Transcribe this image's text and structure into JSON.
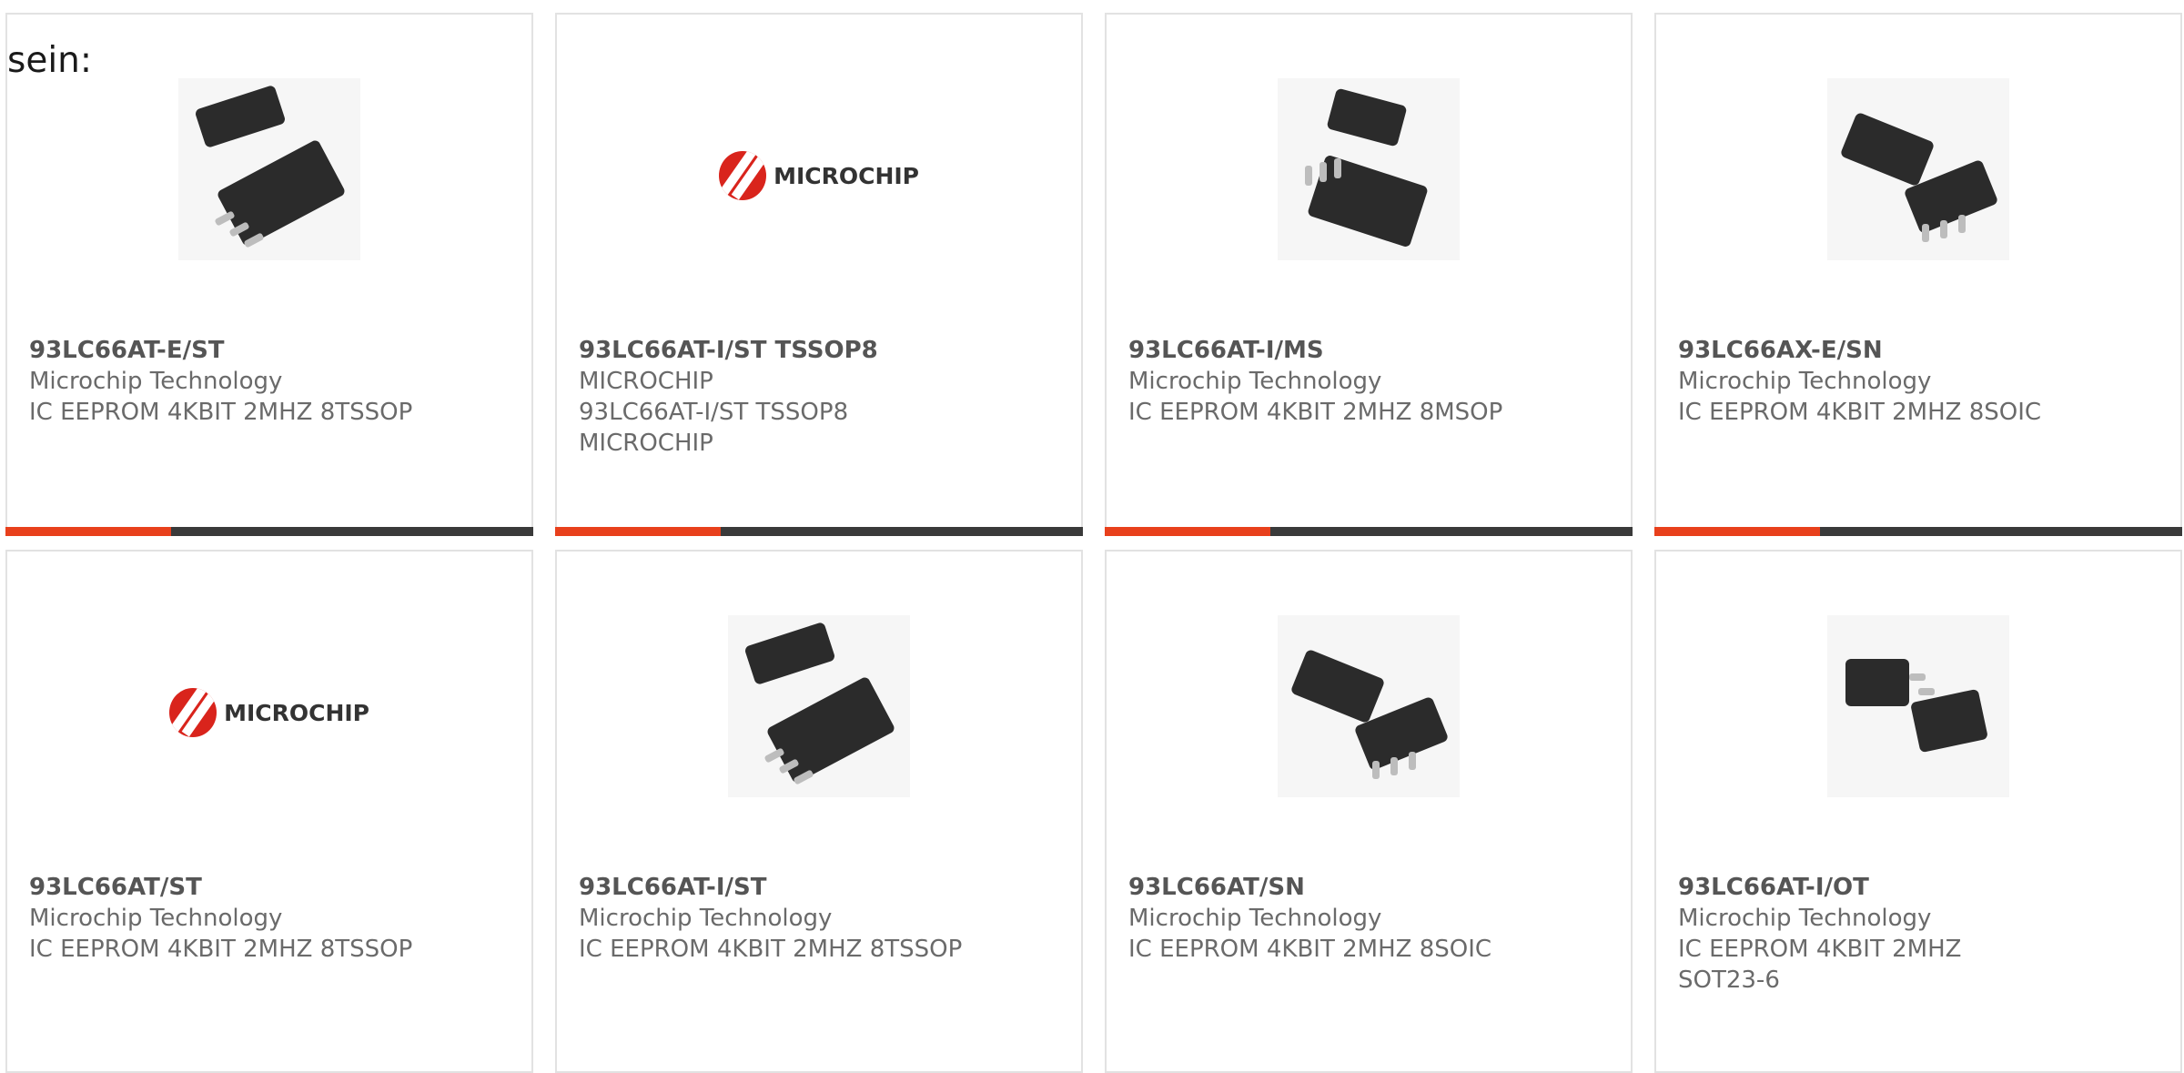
{
  "intro_text": "sein:",
  "colors": {
    "accent": "#e8401c",
    "bar": "#3a3a3a",
    "text": "#6a6a6a"
  },
  "products": [
    {
      "part": "93LC66AT-E/ST",
      "line1": "Microchip Technology",
      "line2": "IC EEPROM 4KBIT 2MHZ 8TSSOP",
      "line3": "",
      "image": "tssop-chip-photo"
    },
    {
      "part": "93LC66AT-I/ST TSSOP8",
      "line1": "MICROCHIP",
      "line2": "93LC66AT-I/ST TSSOP8",
      "line3": "MICROCHIP",
      "image": "microchip-logo",
      "logo_text": "MICROCHIP"
    },
    {
      "part": "93LC66AT-I/MS",
      "line1": "Microchip Technology",
      "line2": "IC EEPROM 4KBIT 2MHZ 8MSOP",
      "line3": "",
      "image": "msop-chip-photo"
    },
    {
      "part": "93LC66AX-E/SN",
      "line1": "Microchip Technology",
      "line2": "IC EEPROM 4KBIT 2MHZ 8SOIC",
      "line3": "",
      "image": "soic-chip-photo"
    },
    {
      "part": "93LC66AT/ST",
      "line1": "Microchip Technology",
      "line2": "IC EEPROM 4KBIT 2MHZ 8TSSOP",
      "line3": "",
      "image": "microchip-logo",
      "logo_text": "MICROCHIP"
    },
    {
      "part": "93LC66AT-I/ST",
      "line1": "Microchip Technology",
      "line2": "IC EEPROM 4KBIT 2MHZ 8TSSOP",
      "line3": "",
      "image": "tssop-chip-photo"
    },
    {
      "part": "93LC66AT/SN",
      "line1": "Microchip Technology",
      "line2": "IC EEPROM 4KBIT 2MHZ 8SOIC",
      "line3": "",
      "image": "soic-chip-photo"
    },
    {
      "part": "93LC66AT-I/OT",
      "line1": "Microchip Technology",
      "line2": "IC EEPROM 4KBIT 2MHZ SOT23-6",
      "line3": "",
      "image": "sot23-chip-photo"
    }
  ]
}
